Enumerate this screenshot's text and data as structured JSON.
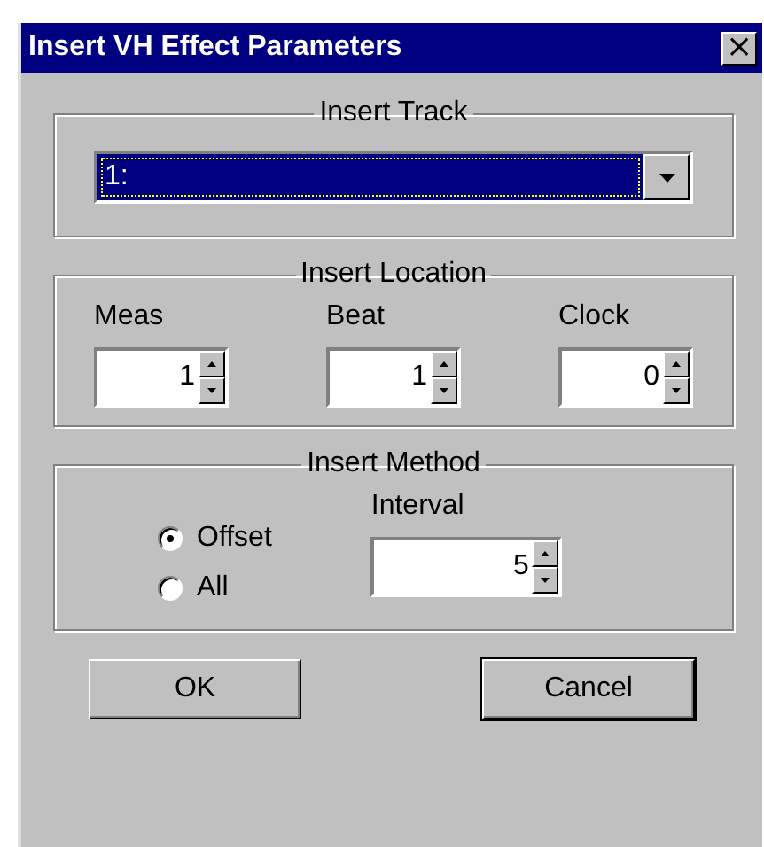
{
  "window": {
    "title": "Insert VH Effect Parameters",
    "close": "×"
  },
  "insert_track": {
    "legend": "Insert Track",
    "value": "1:"
  },
  "insert_location": {
    "legend": "Insert Location",
    "fields": [
      {
        "label": "Meas",
        "value": "1"
      },
      {
        "label": "Beat",
        "value": "1"
      },
      {
        "label": "Clock",
        "value": "0"
      }
    ]
  },
  "insert_method": {
    "legend": "Insert Method",
    "options": [
      {
        "label": "Offset",
        "selected": true
      },
      {
        "label": "All",
        "selected": false
      }
    ],
    "interval": {
      "label": "Interval",
      "value": "5"
    }
  },
  "buttons": [
    {
      "label": "OK",
      "default": false
    },
    {
      "label": "Cancel",
      "default": true
    }
  ]
}
